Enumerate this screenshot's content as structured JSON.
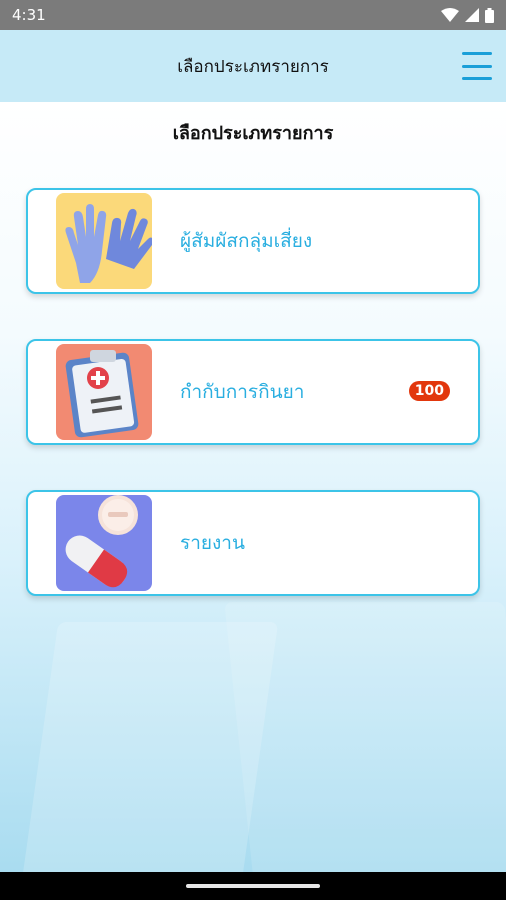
{
  "status_bar": {
    "time": "4:31"
  },
  "app_bar": {
    "title": "เลือกประเภทรายการ",
    "menu_icon": "hamburger-menu-icon"
  },
  "page": {
    "heading": "เลือกประเภทรายการ"
  },
  "cards": [
    {
      "label": "ผู้สัมผัสกลุ่มเสี่ยง",
      "icon": "gloves-icon",
      "icon_bg": "#fbd97a"
    },
    {
      "label": "กำกับการกินยา",
      "icon": "clipboard-medical-icon",
      "icon_bg": "#f28a72",
      "badge": "100"
    },
    {
      "label": "รายงาน",
      "icon": "pill-capsule-icon",
      "icon_bg": "#7b86ea"
    }
  ],
  "colors": {
    "accent": "#29aee0",
    "card_border": "#3cc4e8",
    "appbar": "#c6eaf7",
    "badge": "#e2370d"
  }
}
